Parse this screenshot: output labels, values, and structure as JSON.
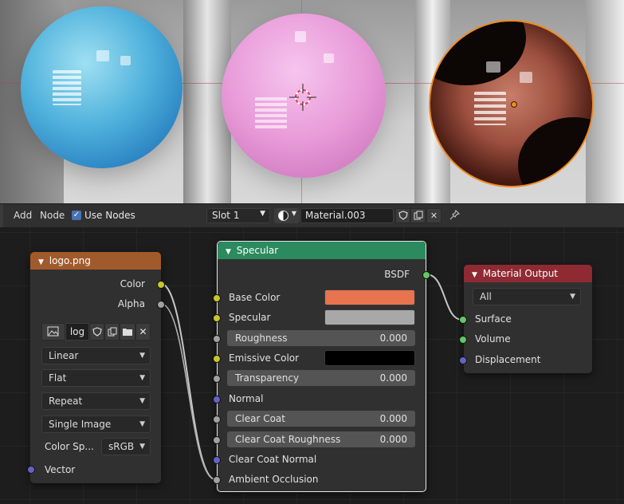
{
  "header": {
    "menus": [
      "Add",
      "Node"
    ],
    "use_nodes_label": "Use Nodes",
    "use_nodes_checked": true,
    "slot_value": "Slot 1",
    "material_name": "Material.003"
  },
  "image_node": {
    "title": "logo.png",
    "outputs": [
      "Color",
      "Alpha"
    ],
    "image_name": "log",
    "interpolation": "Linear",
    "projection": "Flat",
    "extension": "Repeat",
    "source": "Single Image",
    "color_space_label": "Color Sp...",
    "color_space_value": "sRGB",
    "input_vector": "Vector"
  },
  "specular_node": {
    "title": "Specular",
    "output": "BSDF",
    "base_color_label": "Base Color",
    "base_color": "#e8734f",
    "specular_label": "Specular",
    "specular_color": "#a8a8a8",
    "roughness_label": "Roughness",
    "roughness_value": "0.000",
    "emissive_label": "Emissive Color",
    "emissive_color": "#000000",
    "transparency_label": "Transparency",
    "transparency_value": "0.000",
    "normal_label": "Normal",
    "clear_coat_label": "Clear Coat",
    "clear_coat_value": "0.000",
    "clear_coat_roughness_label": "Clear Coat Roughness",
    "clear_coat_roughness_value": "0.000",
    "clear_coat_normal_label": "Clear Coat Normal",
    "ambient_occlusion_label": "Ambient Occlusion"
  },
  "output_node": {
    "title": "Material Output",
    "target": "All",
    "inputs": [
      "Surface",
      "Volume",
      "Displacement"
    ]
  },
  "colors": {
    "image_header": "#a15a2c",
    "shader_header": "#2b8a5e",
    "output_header": "#8f2a33",
    "selection": "#f08a1e"
  }
}
